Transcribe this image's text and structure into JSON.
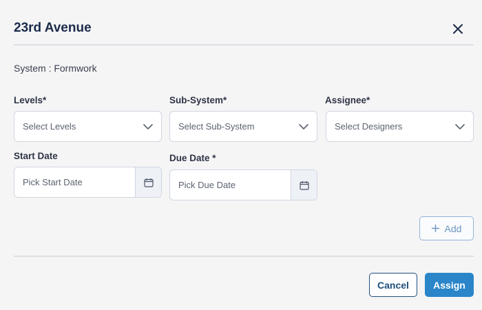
{
  "modal": {
    "title": "23rd Avenue",
    "system_label": "System : Formwork"
  },
  "fields": {
    "levels": {
      "label": "Levels*",
      "placeholder": "Select Levels"
    },
    "subsystem": {
      "label": "Sub-System*",
      "placeholder": "Select Sub-System"
    },
    "assignee": {
      "label": "Assignee*",
      "placeholder": "Select Designers"
    },
    "start_date": {
      "label": "Start Date",
      "placeholder": "Pick Start Date"
    },
    "due_date": {
      "label": "Due Date *",
      "placeholder": "Pick Due Date"
    }
  },
  "actions": {
    "add_label": "Add",
    "cancel_label": "Cancel",
    "assign_label": "Assign"
  },
  "icons": {
    "close": "close-icon",
    "chevron": "chevron-down-icon",
    "calendar": "calendar-icon",
    "plus": "plus-icon"
  },
  "colors": {
    "primary": "#2a86c9",
    "dark_blue": "#1d4f7c",
    "border": "#cfd6e0"
  }
}
